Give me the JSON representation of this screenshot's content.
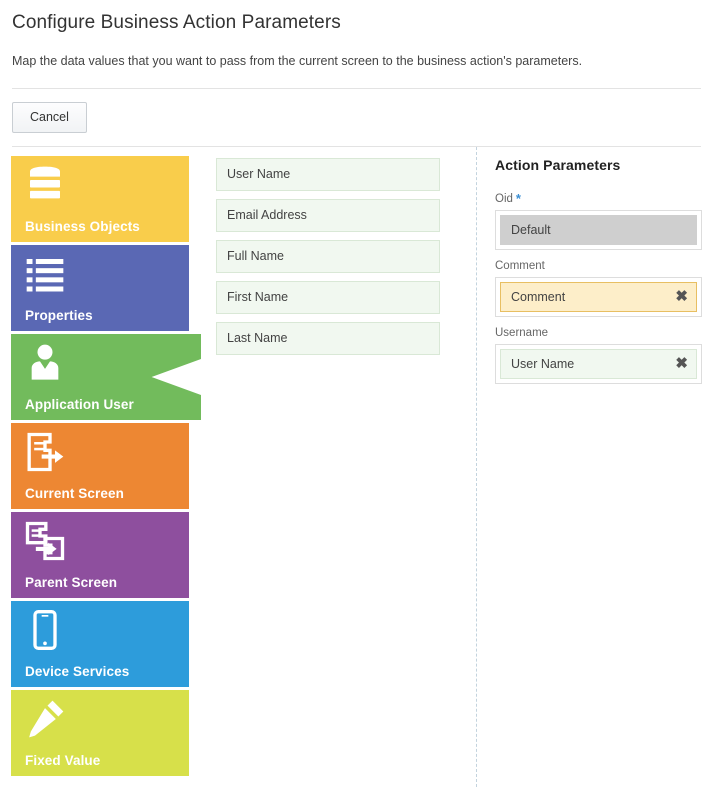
{
  "header": {
    "title": "Configure Business Action Parameters",
    "subtitle": "Map the data values that you want to pass from the current screen to the business action's parameters."
  },
  "toolbar": {
    "cancel_label": "Cancel"
  },
  "source_tiles": [
    {
      "label": "Business Objects",
      "icon": "database-icon",
      "color": "#f9cd4b",
      "selected": false
    },
    {
      "label": "Properties",
      "icon": "list-icon",
      "color": "#5a68b4",
      "selected": false
    },
    {
      "label": "Application User",
      "icon": "user-icon",
      "color": "#72bb5c",
      "selected": true
    },
    {
      "label": "Current Screen",
      "icon": "screen-out-icon",
      "color": "#ed8733",
      "selected": false
    },
    {
      "label": "Parent Screen",
      "icon": "screens-arrow-icon",
      "color": "#8e4f9e",
      "selected": false
    },
    {
      "label": "Device Services",
      "icon": "mobile-phone-icon",
      "color": "#2d9cdb",
      "selected": false
    },
    {
      "label": "Fixed Value",
      "icon": "pencil-icon",
      "color": "#d7e04a",
      "selected": false
    }
  ],
  "source_values": [
    {
      "label": "User Name"
    },
    {
      "label": "Email Address"
    },
    {
      "label": "Full Name"
    },
    {
      "label": "First Name"
    },
    {
      "label": "Last Name"
    }
  ],
  "action_parameters": {
    "title": "Action Parameters",
    "required_marker": "*",
    "remove_glyph": "✖",
    "rows": [
      {
        "label": "Oid",
        "required": true,
        "value": "Default",
        "chip_style": "chip-default",
        "removable": false
      },
      {
        "label": "Comment",
        "required": false,
        "value": "Comment",
        "chip_style": "chip-yellow",
        "removable": true
      },
      {
        "label": "Username",
        "required": false,
        "value": "User Name",
        "chip_style": "chip-green",
        "removable": true
      }
    ]
  },
  "colors": {
    "accent_blue": "#3b8fd4",
    "divider": "#e3e3e3",
    "dashed_divider": "#c3d3de"
  }
}
